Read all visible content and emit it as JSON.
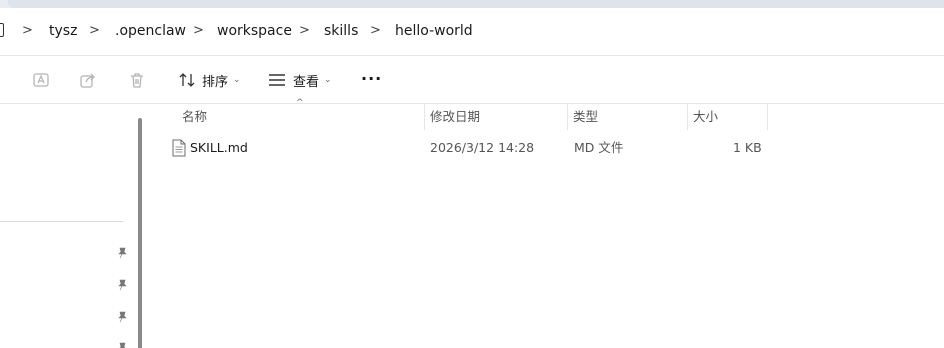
{
  "breadcrumb": {
    "items": [
      "tysz",
      ".openclaw",
      "workspace",
      "skills",
      "hello-world"
    ],
    "separator": ">"
  },
  "toolbar": {
    "sort_label": "排序",
    "view_label": "查看",
    "more_label": "···",
    "icons": [
      "rename-icon",
      "share-icon",
      "delete-icon",
      "sort-icon",
      "view-icon"
    ]
  },
  "list": {
    "columns": {
      "name": "名称",
      "modified": "修改日期",
      "type": "类型",
      "size": "大小"
    },
    "sort_indicator": "^",
    "files": [
      {
        "name": "SKILL.md",
        "modified": "2026/3/12 14:28",
        "type": "MD 文件",
        "size": "1 KB"
      }
    ]
  },
  "colors": {
    "top_strip": "#e9edf3",
    "border": "#e6e6e6",
    "text": "#1a1a1a",
    "muted_text": "#555555"
  }
}
